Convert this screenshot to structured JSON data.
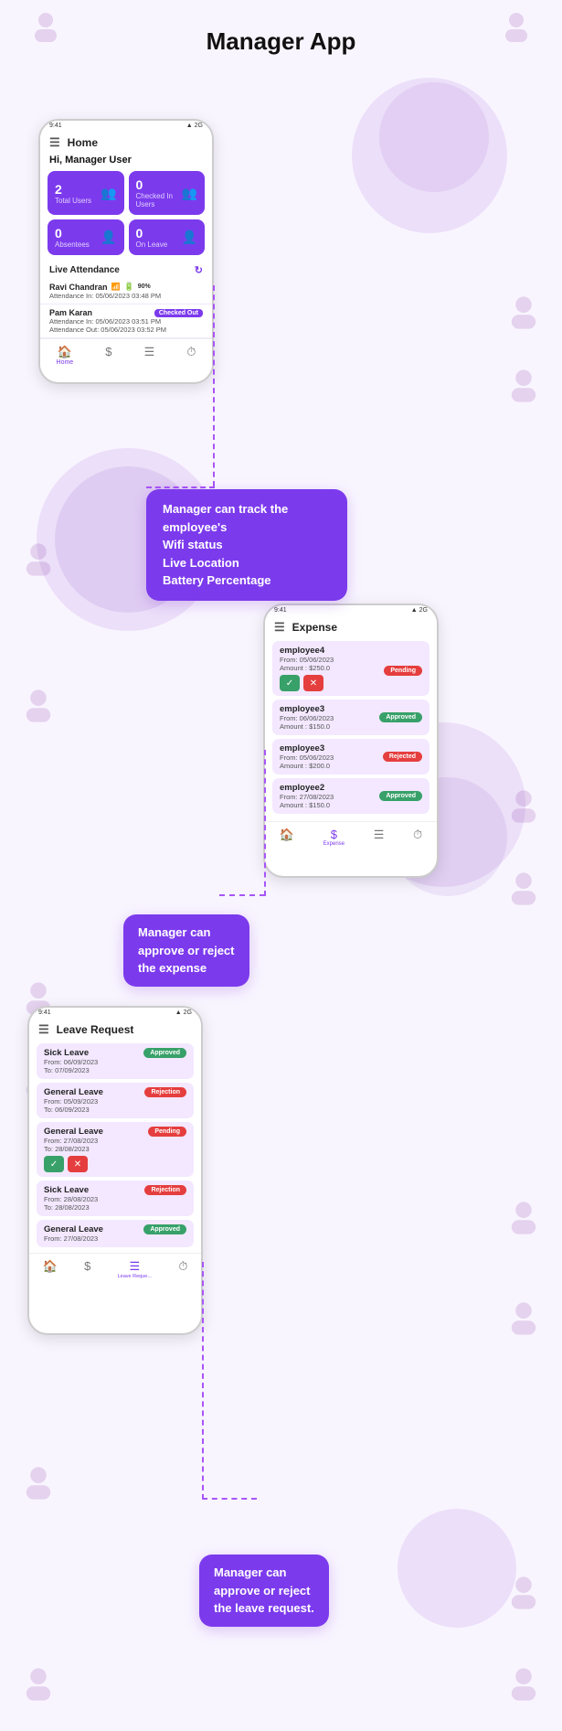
{
  "page": {
    "title": "Manager App",
    "bg_color": "#f9f5ff"
  },
  "section1": {
    "phone": {
      "status_left": "9:41",
      "status_right": "▲ 2G",
      "header": "Home",
      "greeting": "Hi, Manager User",
      "stats": [
        {
          "num": "2",
          "label": "Total Users",
          "icon": "👥"
        },
        {
          "num": "0",
          "label": "Checked In Users",
          "icon": "👥"
        },
        {
          "num": "0",
          "label": "Absentees",
          "icon": "👤"
        },
        {
          "num": "0",
          "label": "On Leave",
          "icon": "👤"
        }
      ],
      "live_attendance_label": "Live Attendance",
      "attendance_rows": [
        {
          "name": "Ravi Chandran",
          "wifi": true,
          "battery": "🔋",
          "bat_pct": "90%",
          "detail": "Attendance In:    05/06/2023 03:48 PM",
          "checked_out": false
        },
        {
          "name": "Pam Karan",
          "wifi": false,
          "battery": "",
          "bat_pct": "",
          "detail1": "Attendance In:   05/06/2023 03:51 PM",
          "detail2": "Attendance Out:  05/06/2023 03:52 PM",
          "checked_out": true,
          "checked_out_label": "Checked Out"
        }
      ],
      "nav": [
        {
          "icon": "🏠",
          "label": "Home",
          "active": true
        },
        {
          "icon": "$",
          "label": "",
          "active": false
        },
        {
          "icon": "☰",
          "label": "",
          "active": false
        },
        {
          "icon": "⏱",
          "label": "",
          "active": false
        }
      ]
    },
    "tooltip": {
      "text_line1": "Manager can track the employee's",
      "text_line2": "Wifi status",
      "text_line3": "Live Location",
      "text_line4": "Battery Percentage"
    }
  },
  "section2": {
    "phone": {
      "status_left": "9:41",
      "status_right": "▲ 2G",
      "header": "Expense",
      "rows": [
        {
          "employee": "employee4",
          "from": "From: 05/06/2023",
          "amount": "Amount : $250.0",
          "status": "Pending",
          "status_class": "badge-pending",
          "has_actions": true
        },
        {
          "employee": "employee3",
          "from": "From: 06/06/2023",
          "amount": "Amount : $150.0",
          "status": "Approved",
          "status_class": "badge-approved",
          "has_actions": false
        },
        {
          "employee": "employee3",
          "from": "From: 05/06/2023",
          "amount": "Amount : $200.0",
          "status": "Rejected",
          "status_class": "badge-rejected",
          "has_actions": false
        },
        {
          "employee": "employee2",
          "from": "From: 27/08/2023",
          "amount": "Amount : $150.0",
          "status": "Approved",
          "status_class": "badge-approved",
          "has_actions": false
        }
      ],
      "nav": [
        {
          "icon": "🏠",
          "label": "",
          "active": false
        },
        {
          "icon": "$",
          "label": "Expense",
          "active": true
        },
        {
          "icon": "☰",
          "label": "",
          "active": false
        },
        {
          "icon": "⏱",
          "label": "",
          "active": false
        }
      ]
    },
    "tooltip": {
      "text_line1": "Manager can",
      "text_line2": "approve or reject",
      "text_line3": "the expense"
    }
  },
  "section3": {
    "phone": {
      "status_left": "9:41",
      "status_right": "▲ 2G",
      "header": "Leave Request",
      "rows": [
        {
          "title": "Sick Leave",
          "from": "From: 06/09/2023",
          "to": "To: 07/09/2023",
          "status": "Approved",
          "status_class": "badge-approved",
          "has_actions": false
        },
        {
          "title": "General Leave",
          "from": "From: 05/09/2023",
          "to": "To: 06/09/2023",
          "status": "Rejection",
          "status_class": "badge-rejected",
          "has_actions": false
        },
        {
          "title": "General Leave",
          "from": "From: 27/08/2023",
          "to": "To: 28/08/2023",
          "status": "Pending",
          "status_class": "badge-pending",
          "has_actions": true
        },
        {
          "title": "Sick Leave",
          "from": "From: 28/08/2023",
          "to": "To: 28/08/2023",
          "status": "Rejection",
          "status_class": "badge-rejected",
          "has_actions": false
        },
        {
          "title": "General Leave",
          "from": "From: 27/08/2023",
          "to": "",
          "status": "Approved",
          "status_class": "badge-approved",
          "has_actions": false
        }
      ],
      "nav": [
        {
          "icon": "🏠",
          "label": "",
          "active": false
        },
        {
          "icon": "$",
          "label": "",
          "active": false
        },
        {
          "icon": "☰",
          "label": "Leave Reque...",
          "active": true
        },
        {
          "icon": "⏱",
          "label": "",
          "active": false
        }
      ]
    },
    "tooltip": {
      "text_line1": "Manager can",
      "text_line2": "approve or reject",
      "text_line3": "the leave request."
    }
  }
}
